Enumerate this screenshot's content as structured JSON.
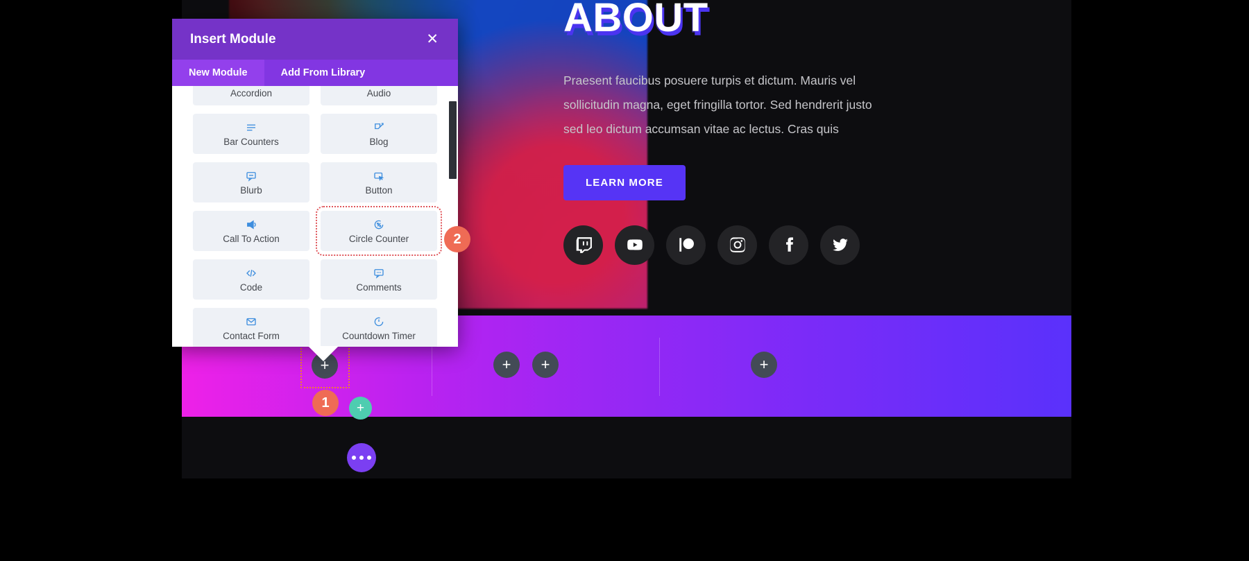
{
  "dialog": {
    "title": "Insert Module",
    "close_icon": "close-icon",
    "tabs": [
      {
        "label": "New Module",
        "active": true
      },
      {
        "label": "Add From Library",
        "active": false
      }
    ],
    "modules": [
      {
        "label": "Accordion",
        "icon": "accordion-icon",
        "highlight": false
      },
      {
        "label": "Audio",
        "icon": "audio-icon",
        "highlight": false
      },
      {
        "label": "Bar Counters",
        "icon": "bar-counters-icon",
        "highlight": false
      },
      {
        "label": "Blog",
        "icon": "blog-icon",
        "highlight": false
      },
      {
        "label": "Blurb",
        "icon": "blurb-icon",
        "highlight": false
      },
      {
        "label": "Button",
        "icon": "button-icon",
        "highlight": false
      },
      {
        "label": "Call To Action",
        "icon": "call-to-action-icon",
        "highlight": false
      },
      {
        "label": "Circle Counter",
        "icon": "circle-counter-icon",
        "highlight": true
      },
      {
        "label": "Code",
        "icon": "code-icon",
        "highlight": false
      },
      {
        "label": "Comments",
        "icon": "comments-icon",
        "highlight": false
      },
      {
        "label": "Contact Form",
        "icon": "contact-form-icon",
        "highlight": false
      },
      {
        "label": "Countdown Timer",
        "icon": "countdown-timer-icon",
        "highlight": false
      }
    ]
  },
  "badges": [
    {
      "number": "1",
      "color": "#ef6b55"
    },
    {
      "number": "2",
      "color": "#ef6b55"
    }
  ],
  "page": {
    "about": {
      "title": "ABOUT",
      "body": "Praesent faucibus posuere turpis et dictum. Mauris vel sollicitudin magna, eget fringilla tortor. Sed hendrerit justo sed leo dictum accumsan vitae ac lectus. Cras quis",
      "cta_label": "LEARN MORE",
      "cta_color": "#5634f5",
      "socials": [
        {
          "name": "twitch-icon"
        },
        {
          "name": "youtube-icon"
        },
        {
          "name": "patreon-icon"
        },
        {
          "name": "instagram-icon"
        },
        {
          "name": "facebook-icon"
        },
        {
          "name": "twitter-icon"
        }
      ]
    },
    "builder": {
      "add_module_label": "+",
      "add_row_label": "+",
      "more_options_label": "…",
      "gradient_start": "#ee21e8",
      "gradient_end": "#5a31fb",
      "accent_teal": "#4ecdb0",
      "accent_purple": "#7b3ff2",
      "selection_color": "#f2802f"
    }
  }
}
